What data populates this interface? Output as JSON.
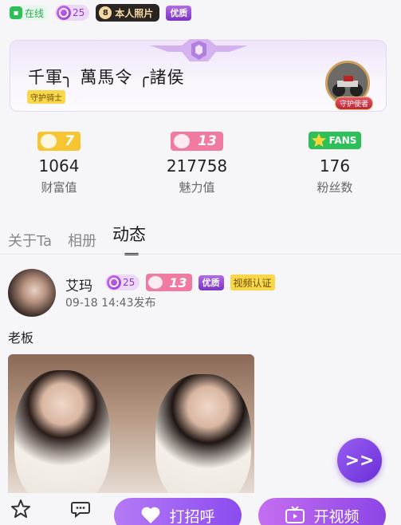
{
  "top_badges": {
    "online": "在线",
    "level": "25",
    "photo": "本人照片",
    "premium": "优质"
  },
  "guardian": {
    "names": "千軍╮ 萬馬令 ╭諸侯",
    "badge": "守护骑士",
    "avatar_label": "守护使者"
  },
  "stats": [
    {
      "badge": "7",
      "value": "1064",
      "label": "财富值"
    },
    {
      "badge": "13",
      "value": "217758",
      "label": "魅力值"
    },
    {
      "badge": "FANS",
      "value": "176",
      "label": "粉丝数"
    }
  ],
  "tabs": [
    "关于Ta",
    "相册",
    "动态"
  ],
  "post": {
    "name": "艾玛",
    "level": "25",
    "charm": "13",
    "premium": "优质",
    "video_verified": "视频认证",
    "time": "09-18 14:43发布",
    "text": "老板"
  },
  "fab": ">>",
  "bottom_bar": {
    "greet": "打招呼",
    "video": "开视频"
  },
  "icons": {
    "favorite": "star-icon",
    "chat": "chat-icon",
    "greet": "heart-icon",
    "video": "tv-icon"
  }
}
